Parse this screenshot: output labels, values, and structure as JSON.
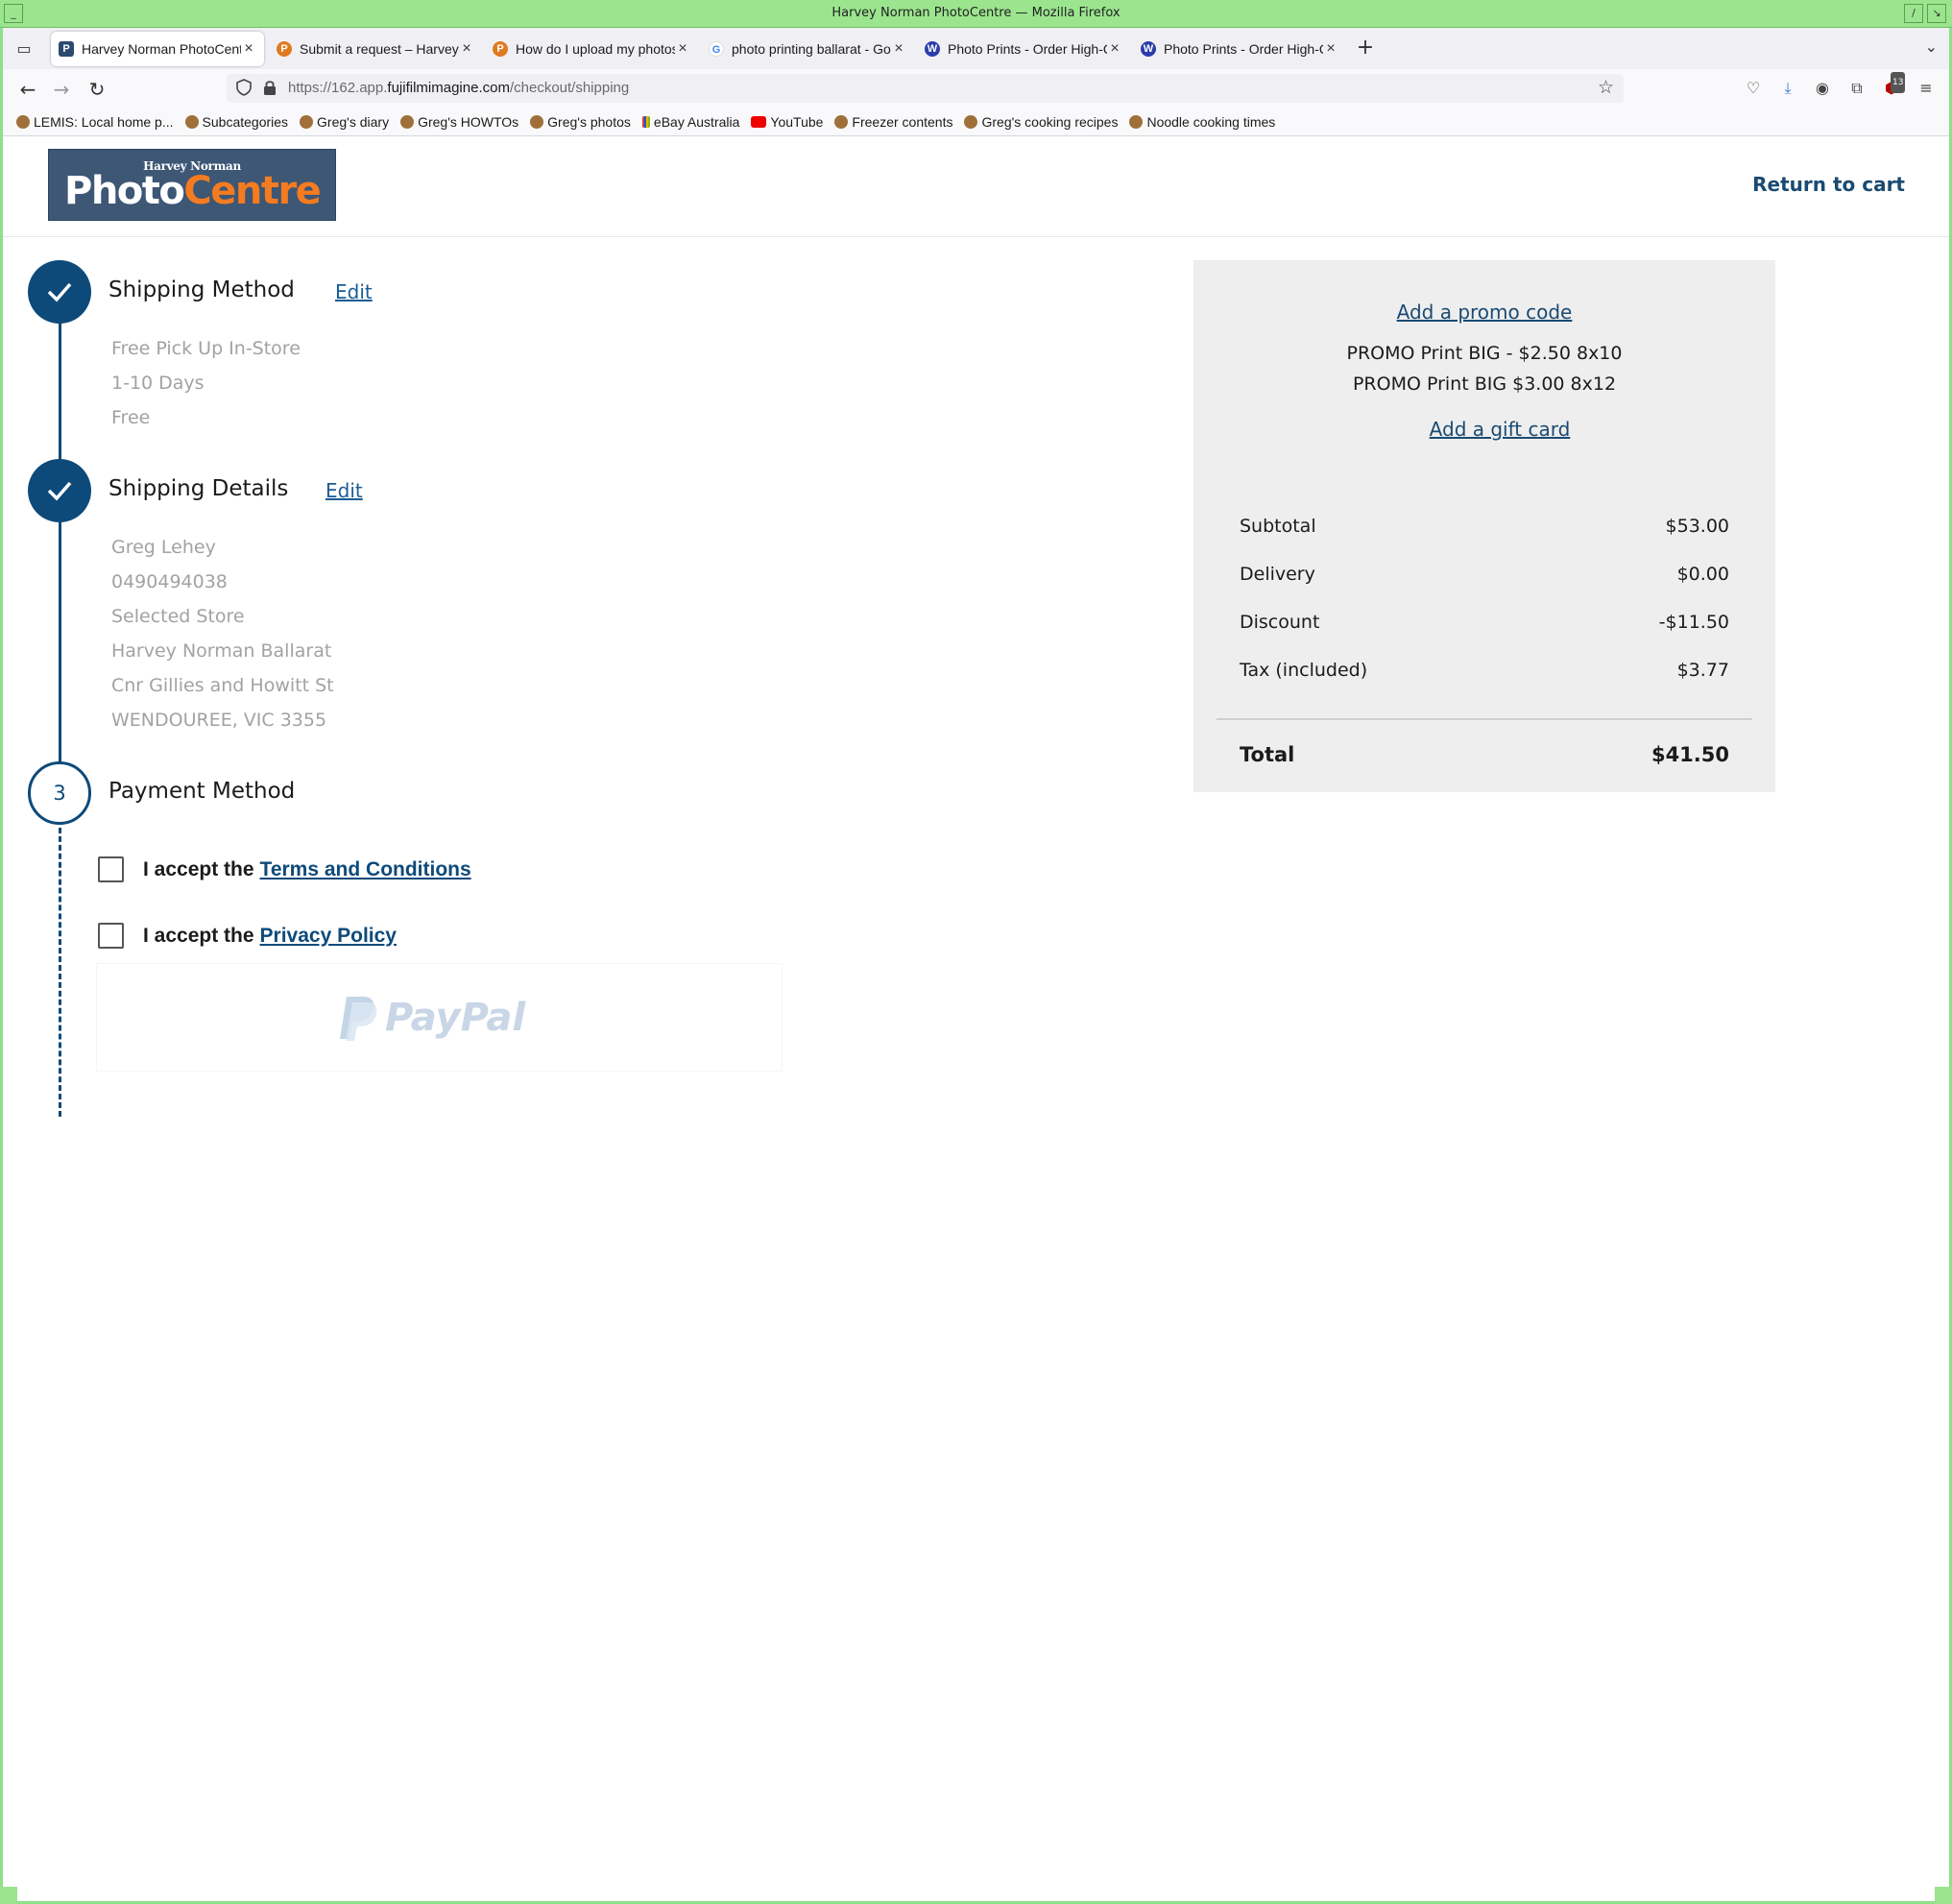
{
  "window": {
    "title": "Harvey Norman PhotoCentre — Mozilla Firefox"
  },
  "tabs": [
    {
      "label": "Harvey Norman PhotoCentre",
      "favicon": "photocentre-favicon",
      "favicon_color": "#2b4a6f",
      "active": true
    },
    {
      "label": "Submit a request – Harvey Norman",
      "favicon": "photocentre-p-favicon",
      "favicon_color": "#e07a1f",
      "active": false
    },
    {
      "label": "How do I upload my photos",
      "favicon": "photocentre-p-favicon",
      "favicon_color": "#e07a1f",
      "active": false
    },
    {
      "label": "photo printing ballarat - Google",
      "favicon": "google-favicon",
      "favicon_color": "#4285f4",
      "active": false
    },
    {
      "label": "Photo Prints - Order High-Quality",
      "favicon": "w-favicon",
      "favicon_color": "#2b3da8",
      "active": false
    },
    {
      "label": "Photo Prints - Order High-Quality",
      "favicon": "w-favicon",
      "favicon_color": "#2b3da8",
      "active": false
    }
  ],
  "nav": {
    "url_prefix": "https://162.app.",
    "url_domain": "fujifilmimagine.com",
    "url_path": "/checkout/shipping",
    "extension_badge": "13"
  },
  "bookmarks": [
    {
      "label": "LEMIS: Local home p...",
      "icon": "avatar-icon"
    },
    {
      "label": "Subcategories",
      "icon": "avatar-icon"
    },
    {
      "label": "Greg's diary",
      "icon": "avatar-icon"
    },
    {
      "label": "Greg's HOWTOs",
      "icon": "avatar-icon"
    },
    {
      "label": "Greg's photos",
      "icon": "avatar-icon"
    },
    {
      "label": "eBay Australia",
      "icon": "ebay-icon"
    },
    {
      "label": "YouTube",
      "icon": "youtube-icon"
    },
    {
      "label": "Freezer contents",
      "icon": "avatar-icon"
    },
    {
      "label": "Greg's cooking recipes",
      "icon": "avatar-icon"
    },
    {
      "label": "Noodle cooking times",
      "icon": "avatar-icon"
    }
  ],
  "header": {
    "logo_small": "Harvey Norman",
    "logo_photo": "Photo",
    "logo_centre": "Centre",
    "return_link": "Return to cart"
  },
  "steps": {
    "shipping_method": {
      "title": "Shipping Method",
      "edit": "Edit",
      "details": [
        "Free Pick Up In-Store",
        "1-10 Days",
        "Free"
      ]
    },
    "shipping_details": {
      "title": "Shipping Details",
      "edit": "Edit",
      "details": [
        "Greg Lehey",
        "0490494038",
        "Selected Store",
        "Harvey Norman Ballarat",
        "Cnr Gillies and Howitt St",
        "WENDOUREE, VIC 3355"
      ]
    },
    "payment_method": {
      "number": "3",
      "title": "Payment Method"
    }
  },
  "consent": {
    "terms_prefix": "I accept the",
    "terms_link": "Terms and Conditions",
    "privacy_prefix": "I accept the",
    "privacy_link": "Privacy Policy"
  },
  "paypal": {
    "label": "PayPal"
  },
  "summary": {
    "promo_link": "Add a promo code",
    "promos": [
      "PROMO Print BIG - $2.50 8x10",
      "PROMO Print BIG $3.00 8x12"
    ],
    "gift_link": "Add a gift card",
    "rows": [
      {
        "label": "Subtotal",
        "value": "$53.00"
      },
      {
        "label": "Delivery",
        "value": "$0.00"
      },
      {
        "label": "Discount",
        "value": "-$11.50"
      },
      {
        "label": "Tax (included)",
        "value": "$3.77"
      }
    ],
    "total_label": "Total",
    "total_value": "$41.50"
  },
  "colors": {
    "brand_blue": "#0d4a7a",
    "brand_orange": "#f47b20",
    "window_frame": "#9be58f"
  }
}
